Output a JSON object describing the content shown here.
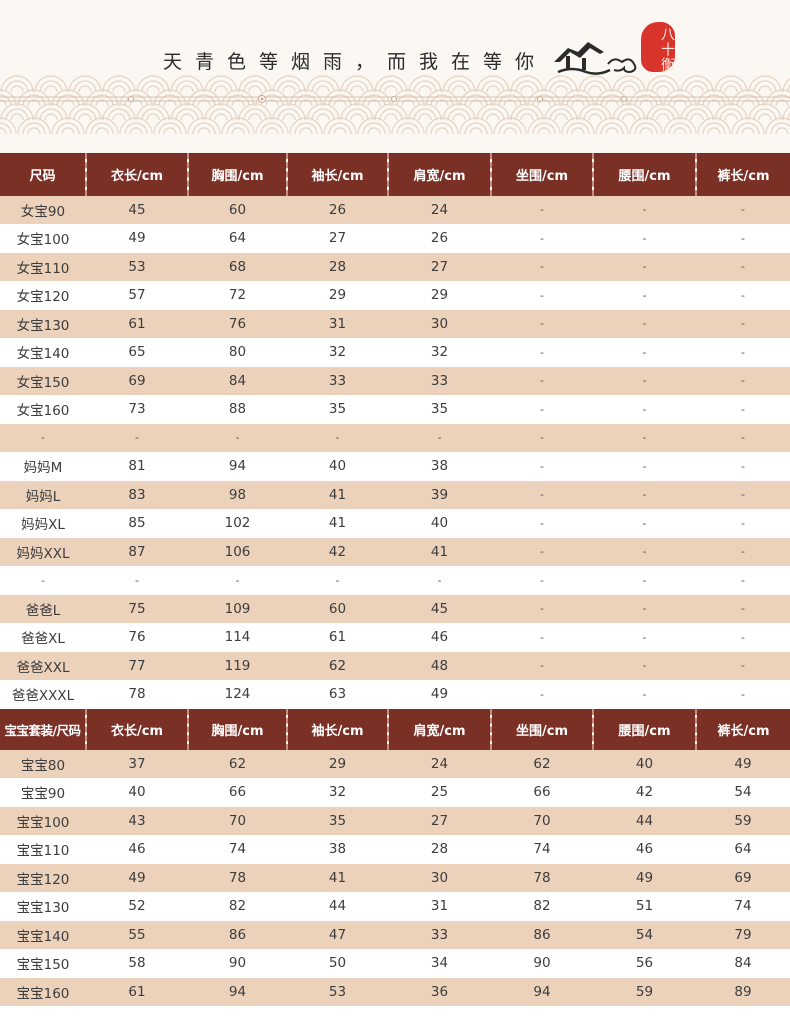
{
  "banner": {
    "slogan": "天青色等烟雨，而我在等你",
    "seal_text": "八十衡",
    "colors": {
      "seal": "#d9342b",
      "background": "#fbf7f2"
    },
    "icons": [
      "house-icon",
      "cloud-icon",
      "seal-stamp-icon"
    ]
  },
  "colors": {
    "header": "#7b3026",
    "row_alt": "#ecd1bb",
    "row": "#ffffff"
  },
  "table1": {
    "headers": [
      "尺码",
      "衣长/cm",
      "胸围/cm",
      "袖长/cm",
      "肩宽/cm",
      "坐围/cm",
      "腰围/cm",
      "裤长/cm"
    ],
    "rows": [
      [
        "女宝90",
        "45",
        "60",
        "26",
        "24",
        "-",
        "-",
        "-"
      ],
      [
        "女宝100",
        "49",
        "64",
        "27",
        "26",
        "-",
        "-",
        "-"
      ],
      [
        "女宝110",
        "53",
        "68",
        "28",
        "27",
        "-",
        "-",
        "-"
      ],
      [
        "女宝120",
        "57",
        "72",
        "29",
        "29",
        "-",
        "-",
        "-"
      ],
      [
        "女宝130",
        "61",
        "76",
        "31",
        "30",
        "-",
        "-",
        "-"
      ],
      [
        "女宝140",
        "65",
        "80",
        "32",
        "32",
        "-",
        "-",
        "-"
      ],
      [
        "女宝150",
        "69",
        "84",
        "33",
        "33",
        "-",
        "-",
        "-"
      ],
      [
        "女宝160",
        "73",
        "88",
        "35",
        "35",
        "-",
        "-",
        "-"
      ],
      [
        "-",
        "-",
        "-",
        "-",
        "-",
        "-",
        "-",
        "-"
      ],
      [
        "妈妈M",
        "81",
        "94",
        "40",
        "38",
        "-",
        "-",
        "-"
      ],
      [
        "妈妈L",
        "83",
        "98",
        "41",
        "39",
        "-",
        "-",
        "-"
      ],
      [
        "妈妈XL",
        "85",
        "102",
        "41",
        "40",
        "-",
        "-",
        "-"
      ],
      [
        "妈妈XXL",
        "87",
        "106",
        "42",
        "41",
        "-",
        "-",
        "-"
      ],
      [
        "-",
        "-",
        "-",
        "-",
        "-",
        "-",
        "-",
        "-"
      ],
      [
        "爸爸L",
        "75",
        "109",
        "60",
        "45",
        "-",
        "-",
        "-"
      ],
      [
        "爸爸XL",
        "76",
        "114",
        "61",
        "46",
        "-",
        "-",
        "-"
      ],
      [
        "爸爸XXL",
        "77",
        "119",
        "62",
        "48",
        "-",
        "-",
        "-"
      ],
      [
        "爸爸XXXL",
        "78",
        "124",
        "63",
        "49",
        "-",
        "-",
        "-"
      ]
    ]
  },
  "table2": {
    "headers": [
      "宝宝套装/尺码",
      "衣长/cm",
      "胸围/cm",
      "袖长/cm",
      "肩宽/cm",
      "坐围/cm",
      "腰围/cm",
      "裤长/cm"
    ],
    "rows": [
      [
        "宝宝80",
        "37",
        "62",
        "29",
        "24",
        "62",
        "40",
        "49"
      ],
      [
        "宝宝90",
        "40",
        "66",
        "32",
        "25",
        "66",
        "42",
        "54"
      ],
      [
        "宝宝100",
        "43",
        "70",
        "35",
        "27",
        "70",
        "44",
        "59"
      ],
      [
        "宝宝110",
        "46",
        "74",
        "38",
        "28",
        "74",
        "46",
        "64"
      ],
      [
        "宝宝120",
        "49",
        "78",
        "41",
        "30",
        "78",
        "49",
        "69"
      ],
      [
        "宝宝130",
        "52",
        "82",
        "44",
        "31",
        "82",
        "51",
        "74"
      ],
      [
        "宝宝140",
        "55",
        "86",
        "47",
        "33",
        "86",
        "54",
        "79"
      ],
      [
        "宝宝150",
        "58",
        "90",
        "50",
        "34",
        "90",
        "56",
        "84"
      ],
      [
        "宝宝160",
        "61",
        "94",
        "53",
        "36",
        "94",
        "59",
        "89"
      ]
    ]
  }
}
